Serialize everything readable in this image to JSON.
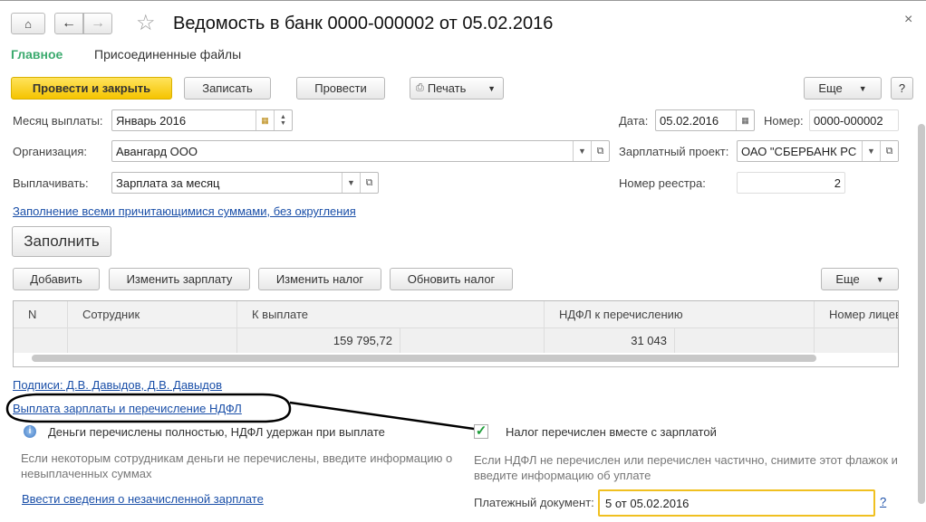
{
  "header": {
    "title": "Ведомость в банк 0000-000002 от 05.02.2016",
    "close": "×"
  },
  "tabs": [
    {
      "label": "Главное",
      "active": true
    },
    {
      "label": "Присоединенные файлы",
      "active": false
    }
  ],
  "toolbar": {
    "post_close": "Провести и закрыть",
    "save": "Записать",
    "post": "Провести",
    "print": "Печать",
    "more": "Еще",
    "help": "?"
  },
  "form": {
    "month_label": "Месяц выплаты:",
    "month_value": "Январь 2016",
    "date_label": "Дата:",
    "date_value": "05.02.2016",
    "number_label": "Номер:",
    "number_value": "0000-000002",
    "org_label": "Организация:",
    "org_value": "Авангард ООО",
    "project_label": "Зарплатный проект:",
    "project_value": "ОАО \"СБЕРБАНК РС",
    "pay_label": "Выплачивать:",
    "pay_value": "Зарплата за месяц",
    "registry_label": "Номер реестра:",
    "registry_value": "2",
    "fill_mode_link": "Заполнение всеми причитающимися суммами, без округления",
    "fill_button": "Заполнить"
  },
  "table_toolbar": {
    "add": "Добавить",
    "change_salary": "Изменить зарплату",
    "change_tax": "Изменить налог",
    "update_tax": "Обновить налог",
    "more": "Еще"
  },
  "table": {
    "columns": [
      "N",
      "Сотрудник",
      "К выплате",
      "НДФЛ к перечислению",
      "Номер лицев"
    ],
    "totals": {
      "payout": "159 795,72",
      "ndfl": "31 043"
    }
  },
  "footer": {
    "signatures_link": "Подписи: Д.В. Давыдов, Д.В. Давыдов",
    "payment_link": "Выплата зарплаты и перечисление НДФЛ",
    "info_text": "Деньги перечислены  полностью, НДФЛ удержан при выплате",
    "left_hint": "Если некоторым сотрудникам деньги не перечислены, введите информацию о невыплаченных суммах",
    "unpaid_link": "Ввести сведения о незачисленной зарплате",
    "tax_checkbox_label": "Налог перечислен вместе с зарплатой",
    "tax_checked": true,
    "right_hint": "Если НДФЛ не перечислен или перечислен частично, снимите этот флажок и введите информацию об уплате",
    "payment_doc_label": "Платежный документ:",
    "payment_doc_value": "5 от 05.02.2016",
    "payment_doc_help": "?"
  }
}
